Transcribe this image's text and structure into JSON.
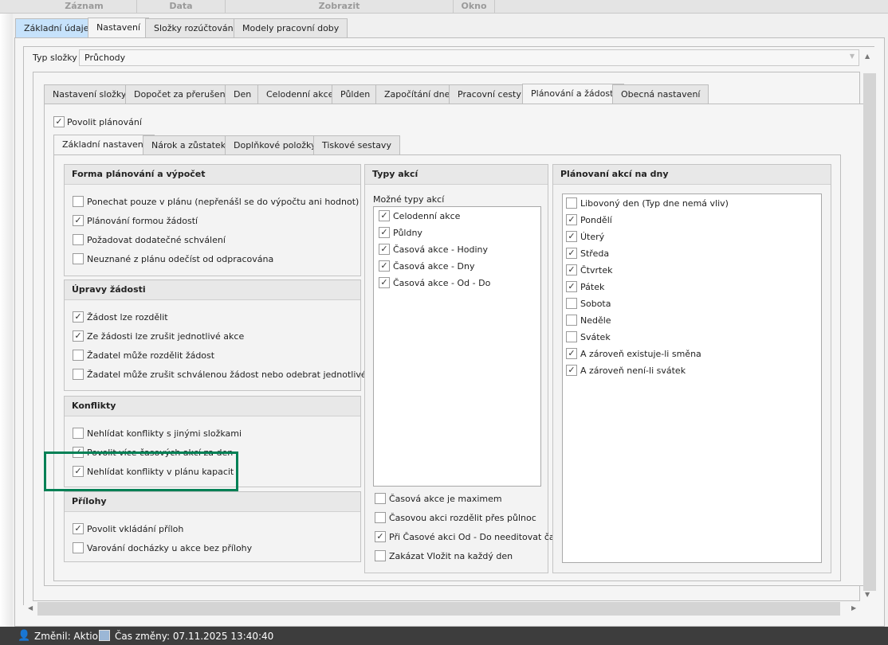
{
  "menu": [
    "Záznam",
    "Data",
    "Zobrazit",
    "Okno"
  ],
  "main_tabs": [
    "Základní údaje",
    "Nastavení",
    "Složky rozúčtování",
    "Modely pracovní doby"
  ],
  "typ_slozky": {
    "label": "Typ složky",
    "value": "Průchody"
  },
  "inner_tabs": [
    "Nastavení složky",
    "Dopočet za přerušení",
    "Den",
    "Celodenní akce",
    "Půlden",
    "Započítání dne",
    "Pracovní cesty",
    "Plánování a žádosti",
    "Obecná nastavení"
  ],
  "povolit_planovani": {
    "label": "Povolit plánování",
    "checked": true
  },
  "sub_tabs": [
    "Základní nastavení",
    "Nárok a zůstatek",
    "Doplňkové položky",
    "Tiskové sestavy"
  ],
  "groups": [
    {
      "title": "Forma plánování a výpočet",
      "items": [
        {
          "label": "Ponechat pouze v plánu (nepřenášl se do výpočtu ani hodnot)",
          "checked": false
        },
        {
          "label": "Plánování formou žádostí",
          "checked": true
        },
        {
          "label": "Požadovat dodatečné schválení",
          "checked": false
        },
        {
          "label": "Neuznané z plánu odečíst od odpracována",
          "checked": false
        }
      ]
    },
    {
      "title": "Úpravy žádosti",
      "items": [
        {
          "label": "Žádost lze rozdělit",
          "checked": true
        },
        {
          "label": "Ze žádosti lze zrušit jednotlivé akce",
          "checked": true
        },
        {
          "label": "Žadatel může rozdělit žádost",
          "checked": false
        },
        {
          "label": "Žadatel může zrušit schválenou žádost nebo odebrat jednotlivé akce",
          "checked": false
        }
      ]
    },
    {
      "title": "Konflikty",
      "items": [
        {
          "label": "Nehlídat konflikty s jinými složkami",
          "checked": false
        },
        {
          "label": "Povolit více časových akcí za den",
          "checked": true
        },
        {
          "label": "Nehlídat konflikty v plánu kapacit",
          "checked": true
        }
      ]
    },
    {
      "title": "Přílohy",
      "items": [
        {
          "label": "Povolit vkládání příloh",
          "checked": true
        },
        {
          "label": "Varování docházky u akce bez přílohy",
          "checked": false
        }
      ]
    }
  ],
  "typy_akci": {
    "title": "Typy akcí",
    "list_label": "Možné typy akcí",
    "items": [
      {
        "label": "Celodenní akce",
        "checked": true
      },
      {
        "label": "Půldny",
        "checked": true
      },
      {
        "label": "Časová akce - Hodiny",
        "checked": true
      },
      {
        "label": "Časová akce - Dny",
        "checked": true
      },
      {
        "label": "Časová akce - Od - Do",
        "checked": true
      }
    ],
    "options": [
      {
        "label": "Časová akce je maximem",
        "checked": false
      },
      {
        "label": "Časovou akci rozdělit přes půlnoc",
        "checked": false
      },
      {
        "label": "Při Časové akci Od - Do needitovat čas",
        "checked": true
      },
      {
        "label": "Zakázat Vložit na každý den",
        "checked": false
      }
    ]
  },
  "planovani_dny": {
    "title": "Plánovaní akcí na dny",
    "items": [
      {
        "label": "Libovoný den (Typ dne nemá vliv)",
        "checked": false
      },
      {
        "label": "Pondělí",
        "checked": true
      },
      {
        "label": "Úterý",
        "checked": true
      },
      {
        "label": "Středa",
        "checked": true
      },
      {
        "label": "Čtvrtek",
        "checked": true
      },
      {
        "label": "Pátek",
        "checked": true
      },
      {
        "label": "Sobota",
        "checked": false
      },
      {
        "label": "Neděle",
        "checked": false
      },
      {
        "label": "Svátek",
        "checked": false
      },
      {
        "label": "A zároveň existuje-li směna",
        "checked": true
      },
      {
        "label": "A zároveň není-li svátek",
        "checked": true
      }
    ]
  },
  "status": {
    "changed_by": "Změnil: Aktion",
    "changed_time": "Čas změny: 07.11.2025 13:40:40"
  },
  "colors": {
    "highlight_box": "#008055",
    "active_tab": "#c6e2fb"
  }
}
